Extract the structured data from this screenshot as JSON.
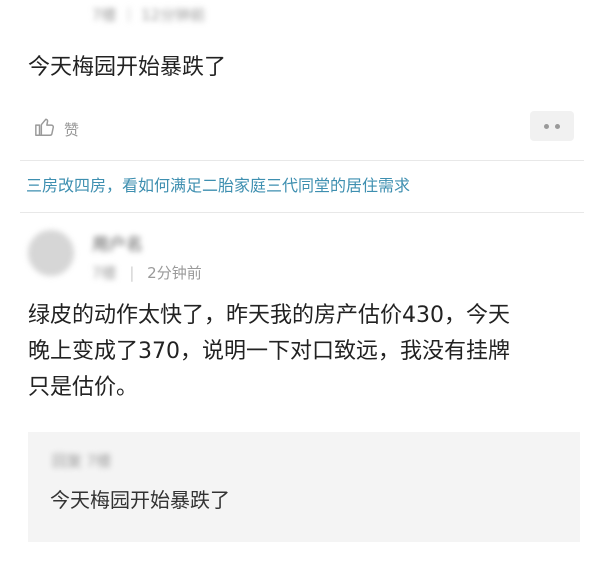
{
  "comment_top": {
    "floor": "7楼",
    "time": "12分钟前",
    "text": "今天梅园开始暴跌了",
    "like_label": "赞"
  },
  "ad_link": {
    "text": "三房改四房，看如何满足二胎家庭三代同堂的居住需求"
  },
  "comment_bottom": {
    "username": "用户名",
    "floor": "7楼",
    "time": "2分钟前",
    "lines": [
      "绿皮的动作太快了，昨天我的房产估价430，今天",
      "晚上变成了370，说明一下对口致远，我没有挂牌",
      "只是估价。"
    ],
    "quote": {
      "header": "回复 7楼",
      "text": "今天梅园开始暴跌了"
    }
  },
  "colors": {
    "link": "#3e8fb0",
    "meta": "#9a9a9a",
    "quote_bg": "#f4f4f4"
  }
}
